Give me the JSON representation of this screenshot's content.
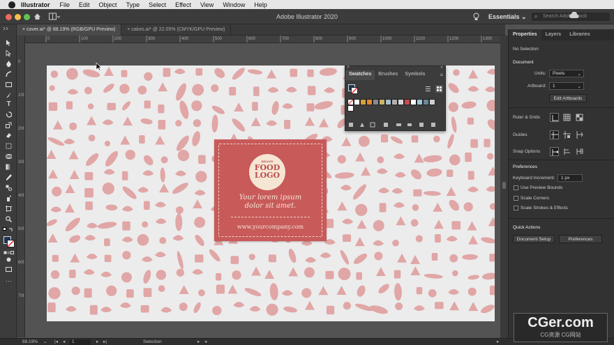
{
  "menubar": {
    "app_name": "Illustrator",
    "items": [
      "File",
      "Edit",
      "Object",
      "Type",
      "Select",
      "Effect",
      "View",
      "Window",
      "Help"
    ]
  },
  "appbar": {
    "title": "Adobe Illustrator 2020",
    "workspace": "Essentials",
    "search_placeholder": "Search Adobe Stock",
    "traffic_colors": [
      "#ed6a5e",
      "#f5bf4f",
      "#61c554"
    ]
  },
  "documents": {
    "tabs": [
      {
        "label": "cover.ai* @ 88.19% (RGB/GPU Preview)",
        "active": true
      },
      {
        "label": "cakes.ai* @ 22.05% (CMYK/GPU Preview)",
        "active": false
      }
    ]
  },
  "rulers": {
    "h_labels": [
      "0",
      "100",
      "200",
      "300",
      "400",
      "500",
      "600",
      "700",
      "800",
      "900",
      "1000",
      "1100",
      "1200",
      "1300"
    ],
    "v_labels": [
      "0",
      "100",
      "200",
      "300",
      "400",
      "500",
      "600",
      "700"
    ]
  },
  "artwork": {
    "pattern_color": "#e1a6a6",
    "card_color": "#c85a5a",
    "logo_line1": "FOOD",
    "logo_line2": "LOGO",
    "logo_small": "BRAND",
    "tagline_line1": "Your lorem ipsum",
    "tagline_line2": "dolor sit amet.",
    "website": "www.yourcompany.com"
  },
  "swatches_panel": {
    "tabs": [
      "Swatches",
      "Brushes",
      "Symbols"
    ],
    "colors": [
      "#ffffff",
      "#000000",
      "#d4a23c",
      "#e08a2c",
      "#8a8a8a",
      "#c8b36a",
      "#a8c0d0",
      "#b0b0b0",
      "#d8d8d8",
      "#c84a4a",
      "#ffffff",
      "#9ec4d6",
      "#6a8a9a",
      "#d0d0d0"
    ]
  },
  "properties_panel": {
    "tabs": [
      "Properties",
      "Layers",
      "Libraries"
    ],
    "selection": "No Selection",
    "document_header": "Document",
    "units_label": "Units:",
    "units_value": "Pixels",
    "artboard_label": "Artboard:",
    "artboard_value": "1",
    "edit_artboards": "Edit Artboards",
    "ruler_grids": "Ruler & Grids",
    "guides": "Guides",
    "snap_options": "Snap Options",
    "preferences_header": "Preferences",
    "keyboard_increment_label": "Keyboard Increment:",
    "keyboard_increment_value": "1 px",
    "use_preview_bounds": "Use Preview Bounds",
    "scale_corners": "Scale Corners",
    "scale_strokes": "Scale Strokes & Effects",
    "quick_actions": "Quick Actions",
    "document_setup": "Document Setup",
    "preferences_button": "Preferences"
  },
  "status": {
    "zoom": "88.19%",
    "artboard": "1",
    "tool": "Selection"
  },
  "watermark": {
    "line1": "CGer.com",
    "line2": "CG资源 CG网站"
  }
}
